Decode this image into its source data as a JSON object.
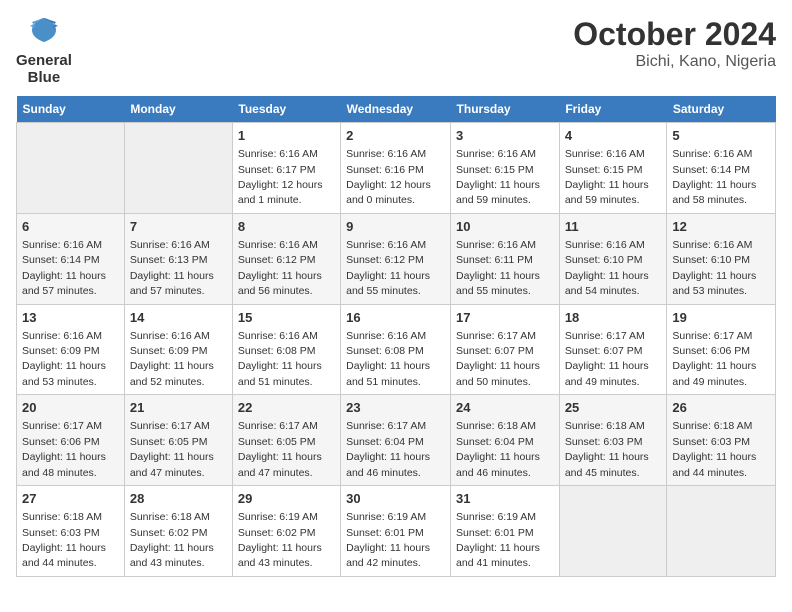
{
  "header": {
    "logo_line1": "General",
    "logo_line2": "Blue",
    "title": "October 2024",
    "subtitle": "Bichi, Kano, Nigeria"
  },
  "columns": [
    "Sunday",
    "Monday",
    "Tuesday",
    "Wednesday",
    "Thursday",
    "Friday",
    "Saturday"
  ],
  "weeks": [
    [
      {
        "day": "",
        "info": ""
      },
      {
        "day": "",
        "info": ""
      },
      {
        "day": "1",
        "info": "Sunrise: 6:16 AM\nSunset: 6:17 PM\nDaylight: 12 hours and 1 minute."
      },
      {
        "day": "2",
        "info": "Sunrise: 6:16 AM\nSunset: 6:16 PM\nDaylight: 12 hours and 0 minutes."
      },
      {
        "day": "3",
        "info": "Sunrise: 6:16 AM\nSunset: 6:15 PM\nDaylight: 11 hours and 59 minutes."
      },
      {
        "day": "4",
        "info": "Sunrise: 6:16 AM\nSunset: 6:15 PM\nDaylight: 11 hours and 59 minutes."
      },
      {
        "day": "5",
        "info": "Sunrise: 6:16 AM\nSunset: 6:14 PM\nDaylight: 11 hours and 58 minutes."
      }
    ],
    [
      {
        "day": "6",
        "info": "Sunrise: 6:16 AM\nSunset: 6:14 PM\nDaylight: 11 hours and 57 minutes."
      },
      {
        "day": "7",
        "info": "Sunrise: 6:16 AM\nSunset: 6:13 PM\nDaylight: 11 hours and 57 minutes."
      },
      {
        "day": "8",
        "info": "Sunrise: 6:16 AM\nSunset: 6:12 PM\nDaylight: 11 hours and 56 minutes."
      },
      {
        "day": "9",
        "info": "Sunrise: 6:16 AM\nSunset: 6:12 PM\nDaylight: 11 hours and 55 minutes."
      },
      {
        "day": "10",
        "info": "Sunrise: 6:16 AM\nSunset: 6:11 PM\nDaylight: 11 hours and 55 minutes."
      },
      {
        "day": "11",
        "info": "Sunrise: 6:16 AM\nSunset: 6:10 PM\nDaylight: 11 hours and 54 minutes."
      },
      {
        "day": "12",
        "info": "Sunrise: 6:16 AM\nSunset: 6:10 PM\nDaylight: 11 hours and 53 minutes."
      }
    ],
    [
      {
        "day": "13",
        "info": "Sunrise: 6:16 AM\nSunset: 6:09 PM\nDaylight: 11 hours and 53 minutes."
      },
      {
        "day": "14",
        "info": "Sunrise: 6:16 AM\nSunset: 6:09 PM\nDaylight: 11 hours and 52 minutes."
      },
      {
        "day": "15",
        "info": "Sunrise: 6:16 AM\nSunset: 6:08 PM\nDaylight: 11 hours and 51 minutes."
      },
      {
        "day": "16",
        "info": "Sunrise: 6:16 AM\nSunset: 6:08 PM\nDaylight: 11 hours and 51 minutes."
      },
      {
        "day": "17",
        "info": "Sunrise: 6:17 AM\nSunset: 6:07 PM\nDaylight: 11 hours and 50 minutes."
      },
      {
        "day": "18",
        "info": "Sunrise: 6:17 AM\nSunset: 6:07 PM\nDaylight: 11 hours and 49 minutes."
      },
      {
        "day": "19",
        "info": "Sunrise: 6:17 AM\nSunset: 6:06 PM\nDaylight: 11 hours and 49 minutes."
      }
    ],
    [
      {
        "day": "20",
        "info": "Sunrise: 6:17 AM\nSunset: 6:06 PM\nDaylight: 11 hours and 48 minutes."
      },
      {
        "day": "21",
        "info": "Sunrise: 6:17 AM\nSunset: 6:05 PM\nDaylight: 11 hours and 47 minutes."
      },
      {
        "day": "22",
        "info": "Sunrise: 6:17 AM\nSunset: 6:05 PM\nDaylight: 11 hours and 47 minutes."
      },
      {
        "day": "23",
        "info": "Sunrise: 6:17 AM\nSunset: 6:04 PM\nDaylight: 11 hours and 46 minutes."
      },
      {
        "day": "24",
        "info": "Sunrise: 6:18 AM\nSunset: 6:04 PM\nDaylight: 11 hours and 46 minutes."
      },
      {
        "day": "25",
        "info": "Sunrise: 6:18 AM\nSunset: 6:03 PM\nDaylight: 11 hours and 45 minutes."
      },
      {
        "day": "26",
        "info": "Sunrise: 6:18 AM\nSunset: 6:03 PM\nDaylight: 11 hours and 44 minutes."
      }
    ],
    [
      {
        "day": "27",
        "info": "Sunrise: 6:18 AM\nSunset: 6:03 PM\nDaylight: 11 hours and 44 minutes."
      },
      {
        "day": "28",
        "info": "Sunrise: 6:18 AM\nSunset: 6:02 PM\nDaylight: 11 hours and 43 minutes."
      },
      {
        "day": "29",
        "info": "Sunrise: 6:19 AM\nSunset: 6:02 PM\nDaylight: 11 hours and 43 minutes."
      },
      {
        "day": "30",
        "info": "Sunrise: 6:19 AM\nSunset: 6:01 PM\nDaylight: 11 hours and 42 minutes."
      },
      {
        "day": "31",
        "info": "Sunrise: 6:19 AM\nSunset: 6:01 PM\nDaylight: 11 hours and 41 minutes."
      },
      {
        "day": "",
        "info": ""
      },
      {
        "day": "",
        "info": ""
      }
    ]
  ]
}
